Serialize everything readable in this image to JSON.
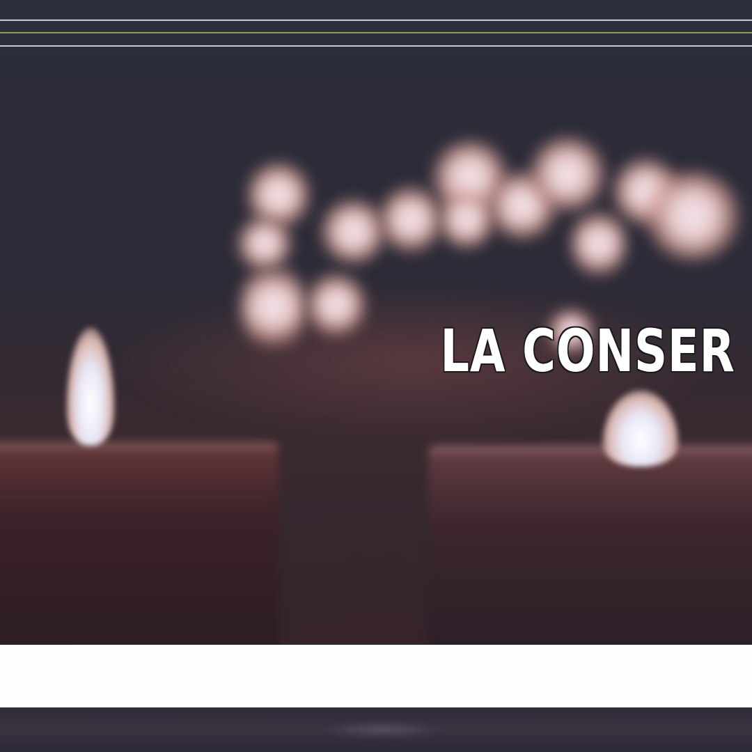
{
  "title": "LA CONSER",
  "colors": {
    "background": "#2b2d3b",
    "rule_light": "#c9c9d2",
    "rule_accent": "#8ea53c",
    "title_text": "#ffffff",
    "band": "#fefefe"
  }
}
